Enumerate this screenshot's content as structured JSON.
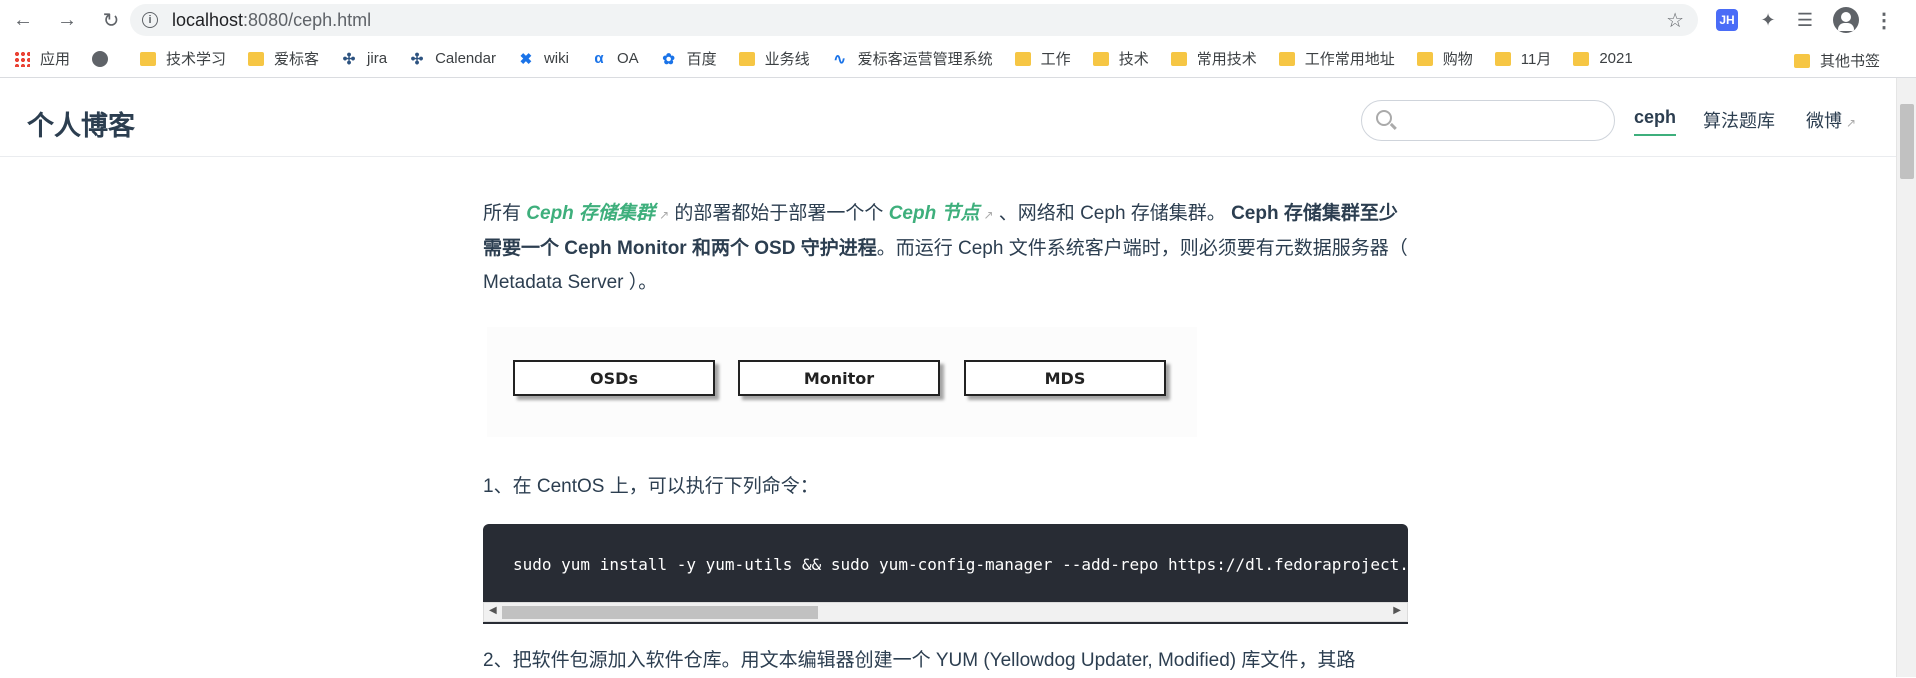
{
  "browser": {
    "url_host": "localhost",
    "url_path": ":8080/ceph.html",
    "extensions": {
      "jh_label": "JH"
    }
  },
  "bookmarks": [
    {
      "label": "应用",
      "icon": "apps-grid-icon"
    },
    {
      "label": "",
      "icon": "globe-icon"
    },
    {
      "label": "技术学习",
      "icon": "folder-icon"
    },
    {
      "label": "爱标客",
      "icon": "folder-icon"
    },
    {
      "label": "jira",
      "icon": "jira-icon"
    },
    {
      "label": "Calendar",
      "icon": "calendar-icon"
    },
    {
      "label": "wiki",
      "icon": "wiki-icon"
    },
    {
      "label": "OA",
      "icon": "oa-icon"
    },
    {
      "label": "百度",
      "icon": "baidu-icon"
    },
    {
      "label": "业务线",
      "icon": "folder-icon"
    },
    {
      "label": "爱标客运营管理系统",
      "icon": "chart-icon"
    },
    {
      "label": "工作",
      "icon": "folder-icon"
    },
    {
      "label": "技术",
      "icon": "folder-icon"
    },
    {
      "label": "常用技术",
      "icon": "folder-icon"
    },
    {
      "label": "工作常用地址",
      "icon": "folder-icon"
    },
    {
      "label": "购物",
      "icon": "folder-icon"
    },
    {
      "label": "11月",
      "icon": "folder-icon"
    },
    {
      "label": "2021",
      "icon": "folder-icon"
    }
  ],
  "bookmarks_other": "其他书签",
  "site": {
    "title": "个人博客",
    "search_placeholder": "",
    "nav": {
      "ceph": "ceph",
      "algo": "算法题库",
      "weibo": "微博"
    }
  },
  "article": {
    "p1": {
      "t1": "所有 ",
      "link1": "Ceph 存储集群",
      "t2": " 的部署都始于部署一个个 ",
      "link2": "Ceph 节点",
      "t3": " 、网络和 Ceph 存储集群。 ",
      "bold": "Ceph 存储集群至少需要一个 Ceph Monitor 和两个 OSD 守护进程",
      "t4": "。而运行 Ceph 文件系统客户端时，则必须要有元数据服务器（ Metadata Server ）。"
    },
    "diagram": {
      "osds": "OSDs",
      "monitor": "Monitor",
      "mds": "MDS"
    },
    "p2": "1、在 CentOS 上，可以执行下列命令：",
    "code": "sudo yum install -y yum-utils && sudo yum-config-manager --add-repo https://dl.fedoraproject.org",
    "p3": "2、把软件包源加入软件仓库。用文本编辑器创建一个 YUM (Yellowdog Updater, Modified) 库文件，其路"
  }
}
